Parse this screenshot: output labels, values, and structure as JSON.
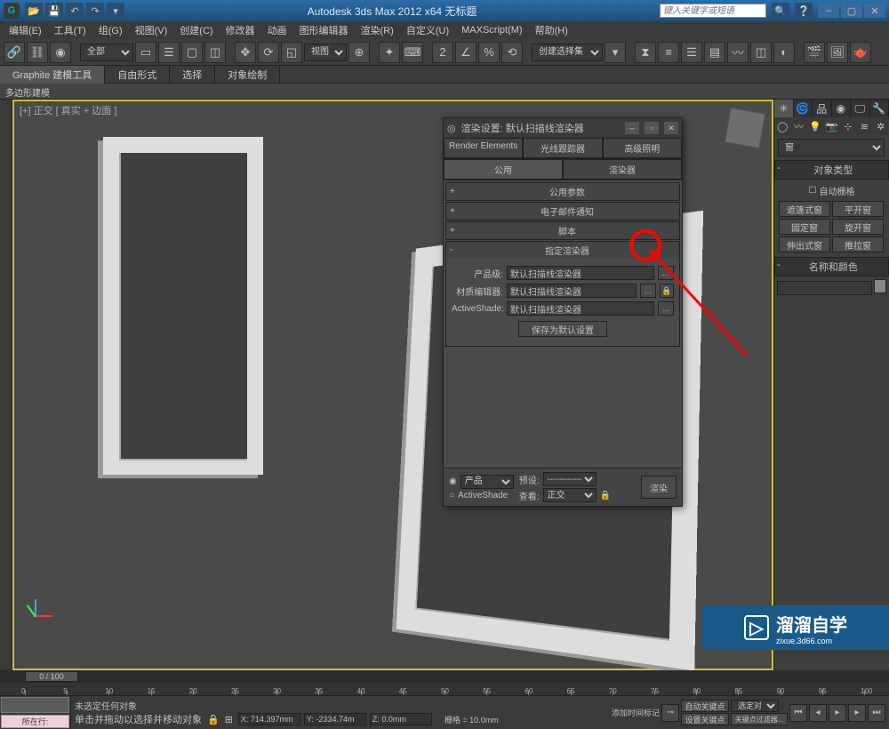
{
  "titlebar": {
    "logo": "G",
    "app_title": "Autodesk 3ds Max 2012 x64   无标题",
    "search_placeholder": "键入关键字或短语"
  },
  "menubar": {
    "items": [
      "编辑(E)",
      "工具(T)",
      "组(G)",
      "视图(V)",
      "创建(C)",
      "修改器",
      "动画",
      "图形编辑器",
      "渲染(R)",
      "自定义(U)",
      "MAXScript(M)",
      "帮助(H)"
    ]
  },
  "maintoolbar": {
    "filter_label": "全部",
    "view_label": "视图",
    "selset_label": "创建选择集"
  },
  "ribbon": {
    "tabs": [
      "Graphite 建模工具",
      "自由形式",
      "选择",
      "对象绘制"
    ],
    "sub": "多边形建模"
  },
  "viewport": {
    "label": "[+] 正交 [ 真实 + 边面 ]"
  },
  "cmdpanel": {
    "category": "窗",
    "rollouts": {
      "object_type": {
        "title": "对象类型",
        "autogrid": "自动栅格",
        "buttons": [
          "遮篷式窗",
          "平开窗",
          "固定窗",
          "旋开窗",
          "伸出式窗",
          "推拉窗"
        ]
      },
      "name_color": {
        "title": "名称和颜色"
      }
    }
  },
  "dialog": {
    "title": "渲染设置: 默认扫描线渲染器",
    "tabs_row1": [
      "Render Elements",
      "光线跟踪器",
      "高级照明"
    ],
    "tabs_row2": [
      "公用",
      "渲染器"
    ],
    "rollouts": [
      {
        "sign": "+",
        "label": "公用参数"
      },
      {
        "sign": "+",
        "label": "电子邮件通知"
      },
      {
        "sign": "+",
        "label": "脚本"
      },
      {
        "sign": "-",
        "label": "指定渲染器"
      }
    ],
    "assign": {
      "prod_label": "产品级:",
      "prod_value": "默认扫描线渲染器",
      "mat_label": "材质编辑器:",
      "mat_value": "默认扫描线渲染器",
      "as_label": "ActiveShade:",
      "as_value": "默认扫描线渲染器",
      "save_btn": "保存为默认设置"
    },
    "footer": {
      "radio1": "产品",
      "radio2": "ActiveShade",
      "preset_label": "预设:",
      "preset_value": "-------------",
      "view_label": "查看:",
      "view_value": "正交",
      "render_btn": "渲染"
    }
  },
  "timeline": {
    "slider": "0 / 100",
    "ticks": [
      "0",
      "5",
      "10",
      "15",
      "20",
      "25",
      "30",
      "35",
      "40",
      "45",
      "50",
      "55",
      "60",
      "65",
      "70",
      "75",
      "80",
      "85",
      "90",
      "95",
      "100"
    ]
  },
  "status": {
    "pending": "所在行:",
    "sel": "未选定任何对象",
    "hint": "单击并拖动以选择并移动对象",
    "lock_icon": "🔒",
    "coords": {
      "x": "X: 714.397mm",
      "y": "Y: -2334.74m",
      "z": "Z: 0.0mm"
    },
    "grid": "栅格 = 10.0mm",
    "addtime": "添加时间标记",
    "autokey": "自动关键点",
    "setkey": "设置关键点",
    "selobj": "选定对象",
    "keyfilter": "关键点过滤器..."
  },
  "watermark": {
    "text": "溜溜自学",
    "url": "zixue.3d66.com"
  }
}
